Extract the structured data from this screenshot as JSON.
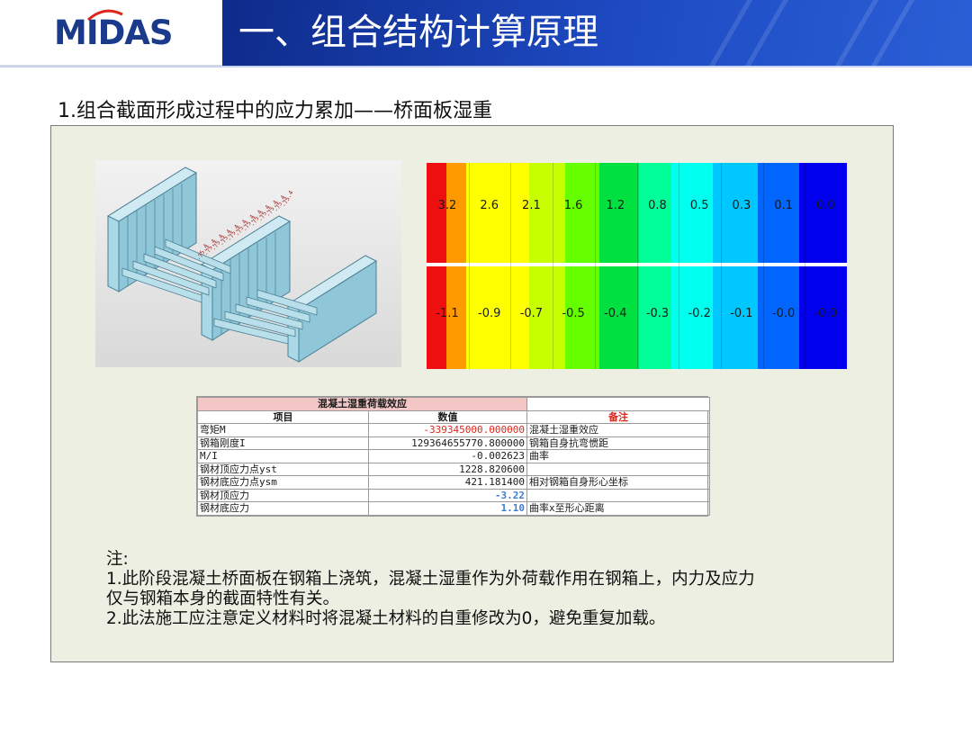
{
  "header": {
    "logo_text": "MIDAS",
    "title": "一、组合结构计算原理",
    "brand_color": "#1b3a8c",
    "title_bar_color": "#1e4bc4"
  },
  "subtitle": "1.组合截面形成过程中的应力累加——桥面板湿重",
  "model_labels": [
    "-75.4",
    "-75.4",
    "-75.4",
    "-75.4",
    "-75.4",
    "-75.4",
    "-75.4",
    "-75.4",
    "-75.4",
    "-75.4",
    "-75.4",
    "-75.4"
  ],
  "contour": {
    "top_values": [
      "3.2",
      "2.6",
      "2.1",
      "1.6",
      "1.2",
      "0.8",
      "0.5",
      "0.3",
      "0.1",
      "0.0"
    ],
    "bottom_values": [
      "-1.1",
      "-0.9",
      "-0.7",
      "-0.5",
      "-0.4",
      "-0.3",
      "-0.2",
      "-0.1",
      "-0.0",
      "-0.0"
    ],
    "band_colors": [
      "#ee1010",
      "#ff9900",
      "#ffff00",
      "#ffff00",
      "#c8ff00",
      "#66ff00",
      "#00e040",
      "#00ff99",
      "#00ffee",
      "#00c8ff",
      "#0066ff",
      "#0000ee"
    ]
  },
  "table": {
    "title": "混凝土湿重荷载效应",
    "headers": [
      "项目",
      "数值",
      "备注"
    ],
    "rows": [
      {
        "item": "弯矩M",
        "value": "-339345000.000000",
        "note": "混凝土湿重效应"
      },
      {
        "item": "钢箱刚度I",
        "value": "129364655770.800000",
        "note": "钢箱自身抗弯惯距"
      },
      {
        "item": "M/I",
        "value": "-0.002623",
        "note": "曲率"
      },
      {
        "item": "钢材顶应力点yst",
        "value": "1228.820600",
        "note": ""
      },
      {
        "item": "钢材底应力点ysm",
        "value": "421.181400",
        "note": "相对钢箱自身形心坐标"
      },
      {
        "item": "钢材顶应力",
        "value": "-3.22",
        "note": ""
      },
      {
        "item": "钢材底应力",
        "value": "1.10",
        "note": "曲率x至形心距离"
      }
    ]
  },
  "notes": {
    "heading": "注:",
    "line1": "1.此阶段混凝土桥面板在钢箱上浇筑，混凝土湿重作为外荷载作用在钢箱上，内力及应力",
    "line2": "仅与钢箱本身的截面特性有关。",
    "line3": "2.此法施工应注意定义材料时将混凝土材料的自重修改为0，避免重复加载。"
  }
}
